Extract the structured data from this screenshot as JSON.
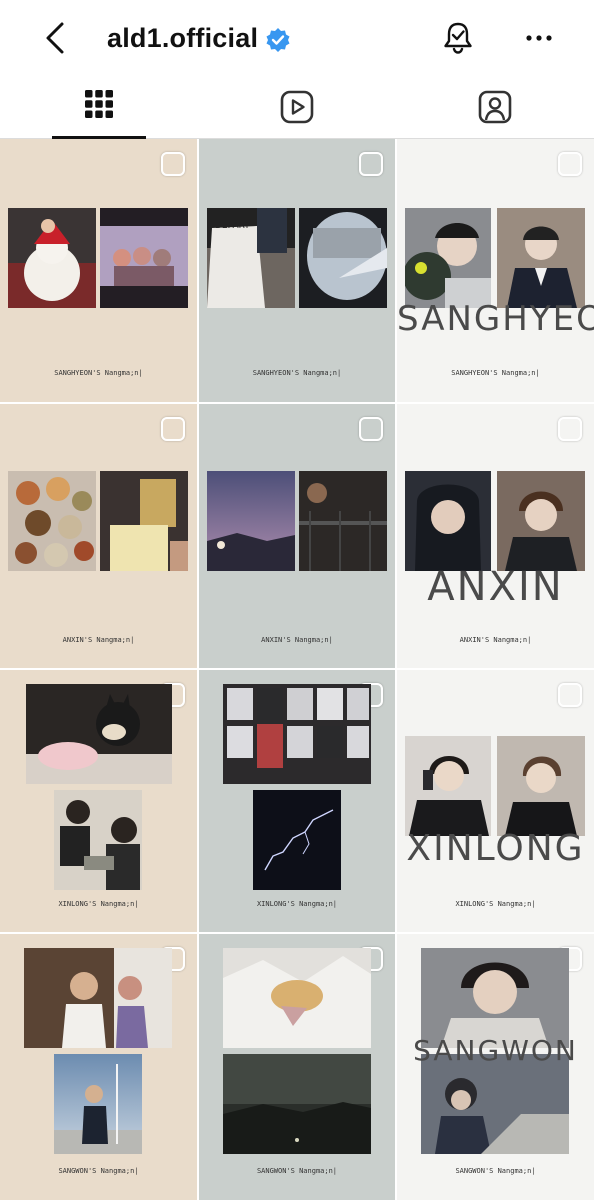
{
  "header": {
    "title": "ald1.official",
    "back_icon": "chevron-left-icon",
    "verified_icon": "verified-badge-icon",
    "verified_color": "#3897f0",
    "bell_icon": "bell-check-icon",
    "more_icon": "more-horizontal-icon"
  },
  "tabs": [
    {
      "name": "grid",
      "icon": "grid-icon",
      "active": true
    },
    {
      "name": "reels",
      "icon": "reels-icon",
      "active": false
    },
    {
      "name": "tagged",
      "icon": "tagged-person-icon",
      "active": false
    }
  ],
  "posts": [
    {
      "caption": "SANGHYEON'S Nangma;n|",
      "overlay": ""
    },
    {
      "caption": "SANGHYEON'S Nangma;n|",
      "overlay": ""
    },
    {
      "caption": "SANGHYEON'S Nangma;n|",
      "overlay": "SANGHYEON"
    },
    {
      "caption": "ANXIN'S Nangma;n|",
      "overlay": ""
    },
    {
      "caption": "ANXIN'S Nangma;n|",
      "overlay": ""
    },
    {
      "caption": "ANXIN'S Nangma;n|",
      "overlay": "ANXIN"
    },
    {
      "caption": "XINLONG'S Nangma;n|",
      "overlay": ""
    },
    {
      "caption": "XINLONG'S Nangma;n|",
      "overlay": ""
    },
    {
      "caption": "XINLONG'S Nangma;n|",
      "overlay": "XINLONG"
    },
    {
      "caption": "SANGWON'S Nangma;n|",
      "overlay": ""
    },
    {
      "caption": "SANGWON'S Nangma;n|",
      "overlay": ""
    },
    {
      "caption": "SANGWON'S Nangma;n|",
      "overlay": "SANGWON"
    }
  ]
}
